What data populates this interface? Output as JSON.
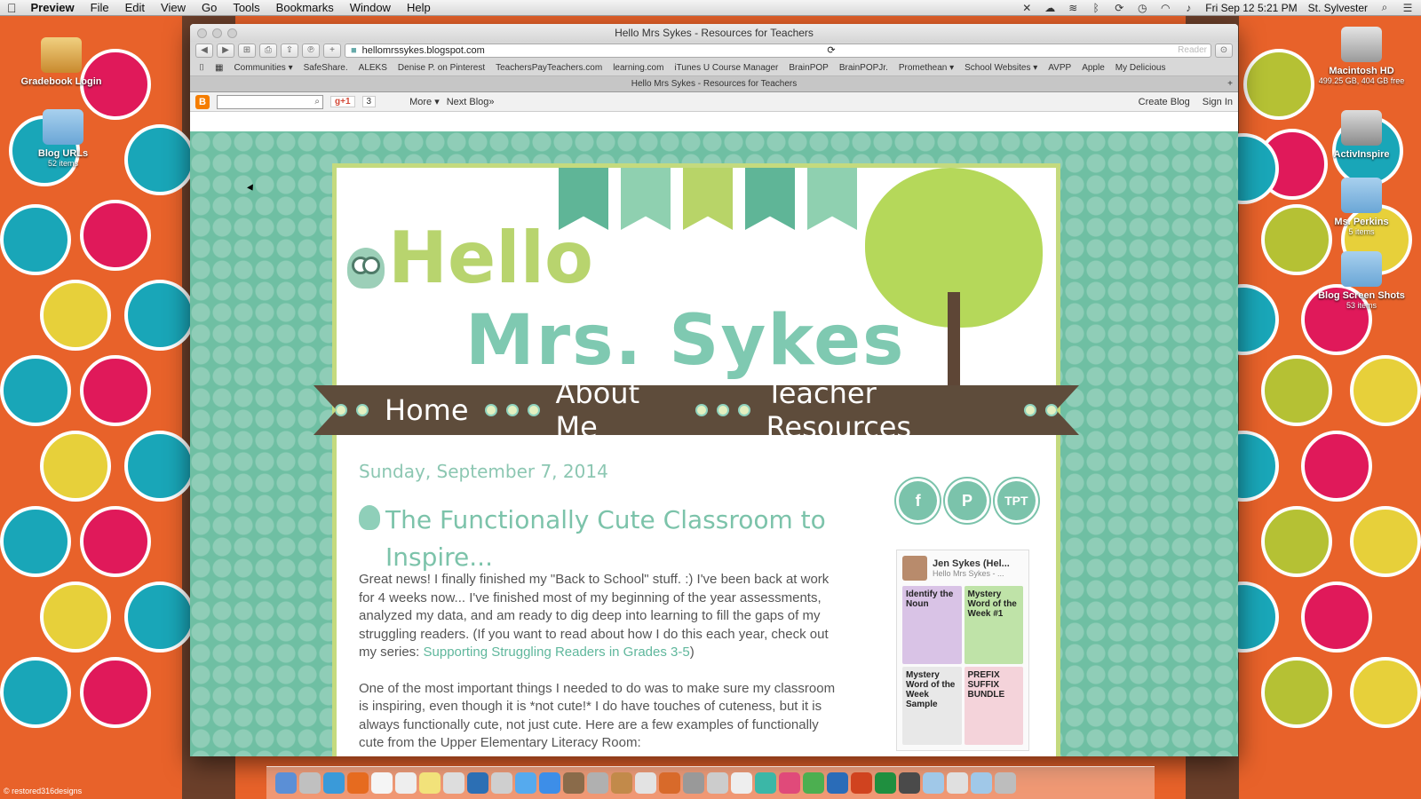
{
  "menubar": {
    "app": "Preview",
    "items": [
      "File",
      "Edit",
      "View",
      "Go",
      "Tools",
      "Bookmarks",
      "Window",
      "Help"
    ],
    "clock": "Fri Sep 12  5:21 PM",
    "user": "St. Sylvester"
  },
  "desktop": {
    "icons_left": [
      {
        "label": "Gradebook Login",
        "sub": ""
      },
      {
        "label": "Blog URLs",
        "sub": "52 items"
      }
    ],
    "icons_right": [
      {
        "label": "Macintosh HD",
        "sub": "499.25 GB, 404 GB free"
      },
      {
        "label": "ActivInspire",
        "sub": ""
      },
      {
        "label": "Ms. Perkins",
        "sub": "5 items"
      },
      {
        "label": "Blog Screen Shots",
        "sub": "53 items"
      }
    ],
    "watermark": "© restored316designs"
  },
  "window": {
    "title": "Hello Mrs Sykes - Resources for Teachers",
    "url": "hellomrssykes.blogspot.com",
    "reader": "Reader",
    "bookmarks": [
      "Communities ▾",
      "SafeShare.",
      "ALEKS",
      "Denise P. on Pinterest",
      "TeachersPayTeachers.com",
      "learning.com",
      "iTunes U Course Manager",
      "BrainPOP",
      "BrainPOPJr.",
      "Promethean ▾",
      "School Websites ▾",
      "AVPP",
      "Apple",
      "My Delicious"
    ],
    "tab_title": "Hello Mrs Sykes - Resources for Teachers"
  },
  "blogger": {
    "gplus": "g+1",
    "gcount": "3",
    "more": "More ▾",
    "next": "Next Blog»",
    "create": "Create Blog",
    "signin": "Sign In"
  },
  "blog": {
    "title_hello": "Hello",
    "title_name": "Mrs. Sykes",
    "nav": [
      "Home",
      "About Me",
      "Teacher Resources"
    ],
    "post_date": "Sunday, September 7, 2014",
    "post_title": "The Functionally Cute Classroom to Inspire...",
    "paragraph1_a": "Great news!  I finally finished my \"Back to School\" stuff.  :)  I've been back at work for 4 weeks now...  I've finished most of my beginning of the year assessments, analyzed my data, and am ready to dig deep into learning to fill the gaps of my struggling readers.  (If you want to read about how I do this each year, check out my series: ",
    "paragraph1_link": "Supporting Struggling Readers in Grades 3-5",
    "paragraph1_b": ")",
    "paragraph2": "One of the most important things I needed to do was to make sure my classroom is inspiring, even though it is *not cute!*  I do have touches of cuteness, but it is always functionally cute, not just cute.  Here are a few examples of functionally cute from the Upper Elementary Literacy Room:",
    "social": [
      "f",
      "P",
      "TPT"
    ],
    "pin_name": "Jen Sykes (Hel...",
    "pin_sub": "Hello Mrs Sykes - ...",
    "pins": [
      {
        "label": "Identify the Noun",
        "color": "#d9c3e6"
      },
      {
        "label": "Mystery Word of the Week #1",
        "color": "#bfe3a8"
      },
      {
        "label": "Mystery Word of the Week Sample",
        "color": "#e8e8e8"
      },
      {
        "label": "PREFIX SUFFIX BUNDLE",
        "color": "#f4d3da"
      }
    ]
  },
  "colors": {
    "page_bg": "#6fbfa3",
    "accent_green": "#c4da7e",
    "nav_brown": "#5e4c3b",
    "title_teal": "#7cc3aa"
  }
}
